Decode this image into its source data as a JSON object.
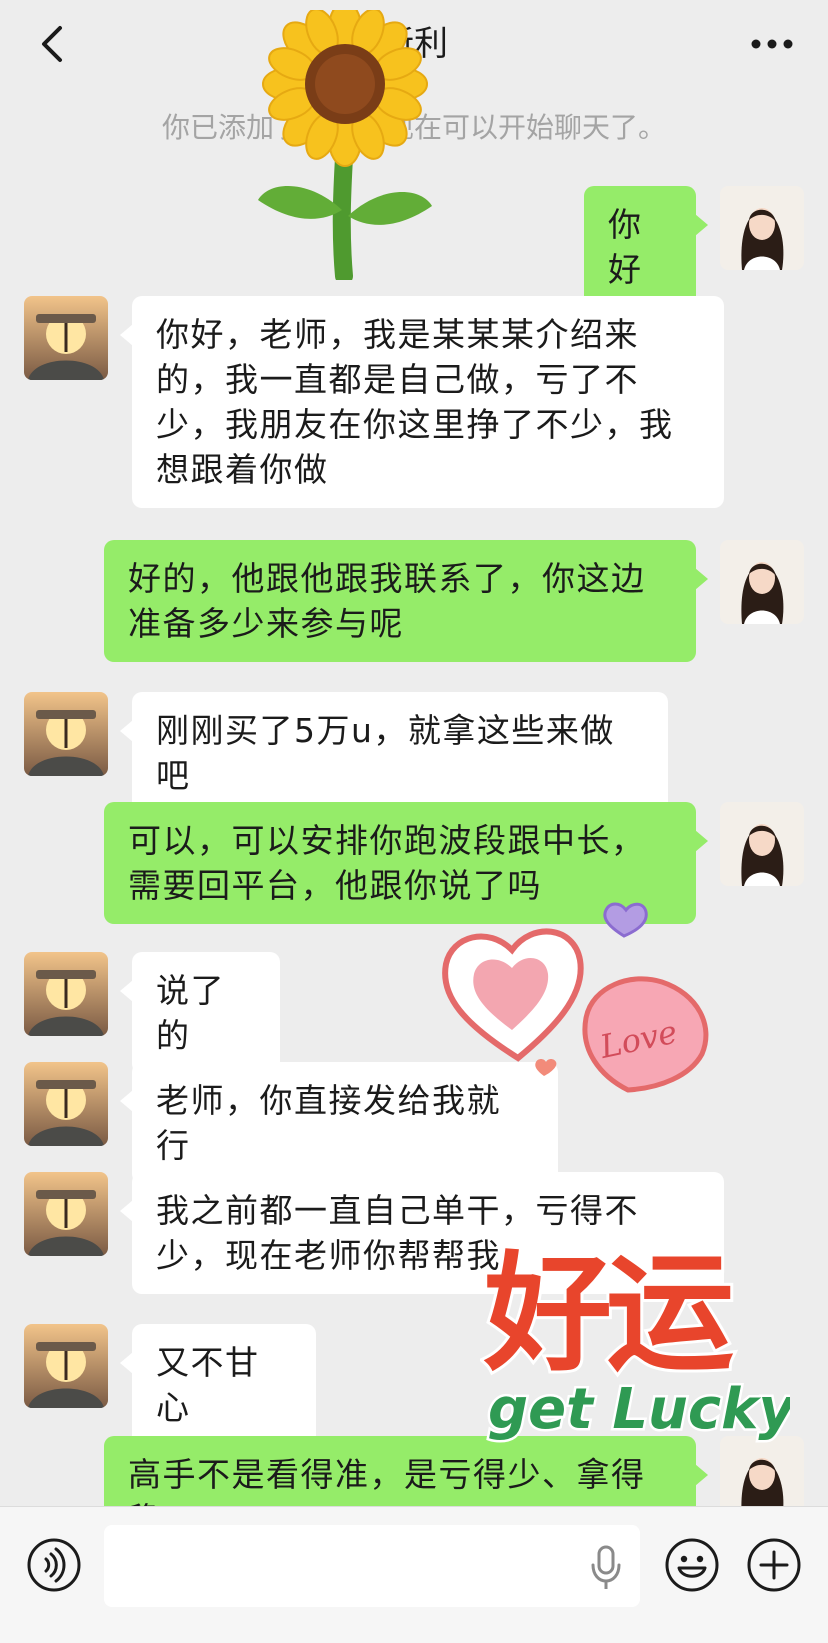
{
  "header": {
    "title": "新利",
    "back_icon": "chevron-left-icon",
    "more_icon": "more-dots-icon"
  },
  "system_message": "你已添加了新利，现在可以开始聊天了。",
  "messages": [
    {
      "side": "right",
      "text": "你好"
    },
    {
      "side": "left",
      "text": "你好，老师，我是某某某介绍来的，我一直都是自己做，亏了不少，我朋友在你这里挣了不少，我想跟着你做"
    },
    {
      "side": "right",
      "text": "好的，他跟他跟我联系了，你这边准备多少来参与呢"
    },
    {
      "side": "left",
      "text": "刚刚买了5万u，就拿这些来做吧"
    },
    {
      "side": "right",
      "text": "可以，可以安排你跑波段跟中长，需要回平台，他跟你说了吗"
    },
    {
      "side": "left",
      "text": "说了的"
    },
    {
      "side": "left",
      "text": "老师，你直接发给我就行"
    },
    {
      "side": "left",
      "text": "我之前都一直自己单干，亏得不少，现在老师你帮帮我"
    },
    {
      "side": "left",
      "text": "又不甘心"
    },
    {
      "side": "right",
      "text": "高手不是看得准，是亏得少、拿得稳"
    }
  ],
  "stickers": {
    "love": "Love",
    "lucky_cn": "好运",
    "lucky_en": "get Lucky"
  },
  "input_bar": {
    "placeholder": "",
    "icons": [
      "voice-icon",
      "microphone-icon",
      "emoji-icon",
      "plus-icon"
    ]
  },
  "colors": {
    "background": "#ededed",
    "outgoing_bubble": "#95ec69",
    "incoming_bubble": "#ffffff",
    "system_text": "#a4a4a4",
    "lucky_red": "#e8452c",
    "lucky_green": "#2f9a53"
  }
}
